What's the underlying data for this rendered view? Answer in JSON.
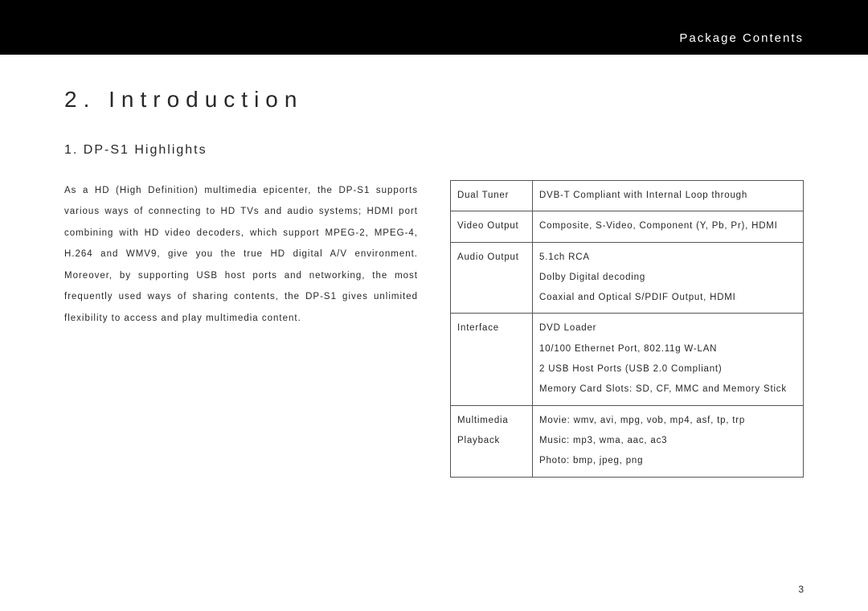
{
  "header": {
    "section_label": "Package Contents"
  },
  "chapter": {
    "title": "2.  Introduction"
  },
  "section": {
    "title": "1. DP-S1 Highlights"
  },
  "body": {
    "paragraph": "As a HD (High Definition) multimedia epicenter, the DP-S1 supports various ways of connecting to HD TVs and audio systems; HDMI port combining with HD video decoders, which support MPEG-2, MPEG-4, H.264 and WMV9, give you the true HD digital A/V environment. Moreover, by supporting USB host ports and networking, the most frequently used ways of sharing contents, the DP-S1 gives unlimited flexibility to access and play multimedia content."
  },
  "spec_table": {
    "rows": [
      {
        "label": "Dual Tuner",
        "lines": [
          "DVB-T Compliant with Internal Loop through"
        ]
      },
      {
        "label": "Video Output",
        "lines": [
          "Composite, S-Video, Component (Y, Pb, Pr), HDMI"
        ]
      },
      {
        "label": "Audio Output",
        "lines": [
          "5.1ch RCA",
          "Dolby Digital decoding",
          "Coaxial and Optical S/PDIF Output, HDMI"
        ]
      },
      {
        "label": "Interface",
        "lines": [
          "DVD Loader",
          "10/100 Ethernet Port, 802.11g W-LAN",
          "2 USB Host Ports (USB 2.0 Compliant)",
          "Memory Card Slots: SD, CF, MMC and Memory Stick"
        ]
      },
      {
        "label": "Multimedia Playback",
        "lines": [
          "Movie: wmv, avi, mpg, vob, mp4, asf, tp, trp",
          "Music: mp3, wma, aac, ac3",
          "Photo: bmp, jpeg, png"
        ]
      }
    ]
  },
  "page_number": "3"
}
